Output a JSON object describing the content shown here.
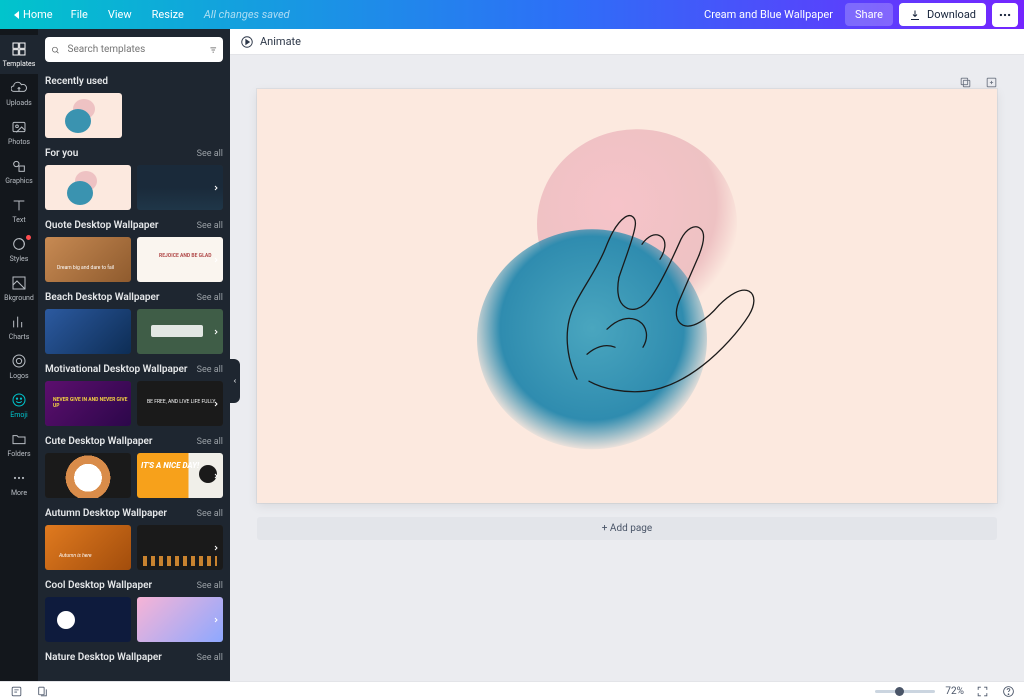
{
  "topbar": {
    "home": "Home",
    "file": "File",
    "view": "View",
    "resize": "Resize",
    "saved": "All changes saved",
    "doc_title": "Cream and Blue Wallpaper",
    "share": "Share",
    "download": "Download"
  },
  "rail": [
    {
      "key": "templates",
      "label": "Templates",
      "active": true
    },
    {
      "key": "uploads",
      "label": "Uploads"
    },
    {
      "key": "photos",
      "label": "Photos"
    },
    {
      "key": "graphics",
      "label": "Graphics"
    },
    {
      "key": "text",
      "label": "Text"
    },
    {
      "key": "styles",
      "label": "Styles",
      "dot": true
    },
    {
      "key": "bkground",
      "label": "Bkground"
    },
    {
      "key": "charts",
      "label": "Charts"
    },
    {
      "key": "logos",
      "label": "Logos"
    },
    {
      "key": "emoji",
      "label": "Emoji",
      "accent": true
    },
    {
      "key": "folders",
      "label": "Folders"
    },
    {
      "key": "more",
      "label": "More"
    }
  ],
  "panel": {
    "search_placeholder": "Search templates",
    "see_all": "See all",
    "sections": {
      "recent": "Recently used",
      "for_you": "For you",
      "quote": "Quote Desktop Wallpaper",
      "beach": "Beach Desktop Wallpaper",
      "motiv": "Motivational Desktop Wallpaper",
      "cute": "Cute Desktop Wallpaper",
      "autumn": "Autumn Desktop Wallpaper",
      "cool": "Cool Desktop Wallpaper",
      "nature": "Nature Desktop Wallpaper"
    },
    "tiles": {
      "quote2": "REJOICE AND BE GLAD",
      "cute2": "IT'S A NICE DAY!",
      "autumn1": "Autumn is here",
      "motiv1": "NEVER GIVE IN AND NEVER GIVE UP",
      "motiv2": "BE FREE, AND LIVE LIFE FULLY",
      "quote1": "Dream big and dare to fail"
    }
  },
  "toolbar": {
    "animate": "Animate"
  },
  "stage": {
    "add_page": "+ Add page"
  },
  "footer": {
    "zoom_label": "72%"
  },
  "colors": {
    "cream": "#fce9df",
    "pink": "#eec2c3",
    "blue": "#2f8caf"
  }
}
